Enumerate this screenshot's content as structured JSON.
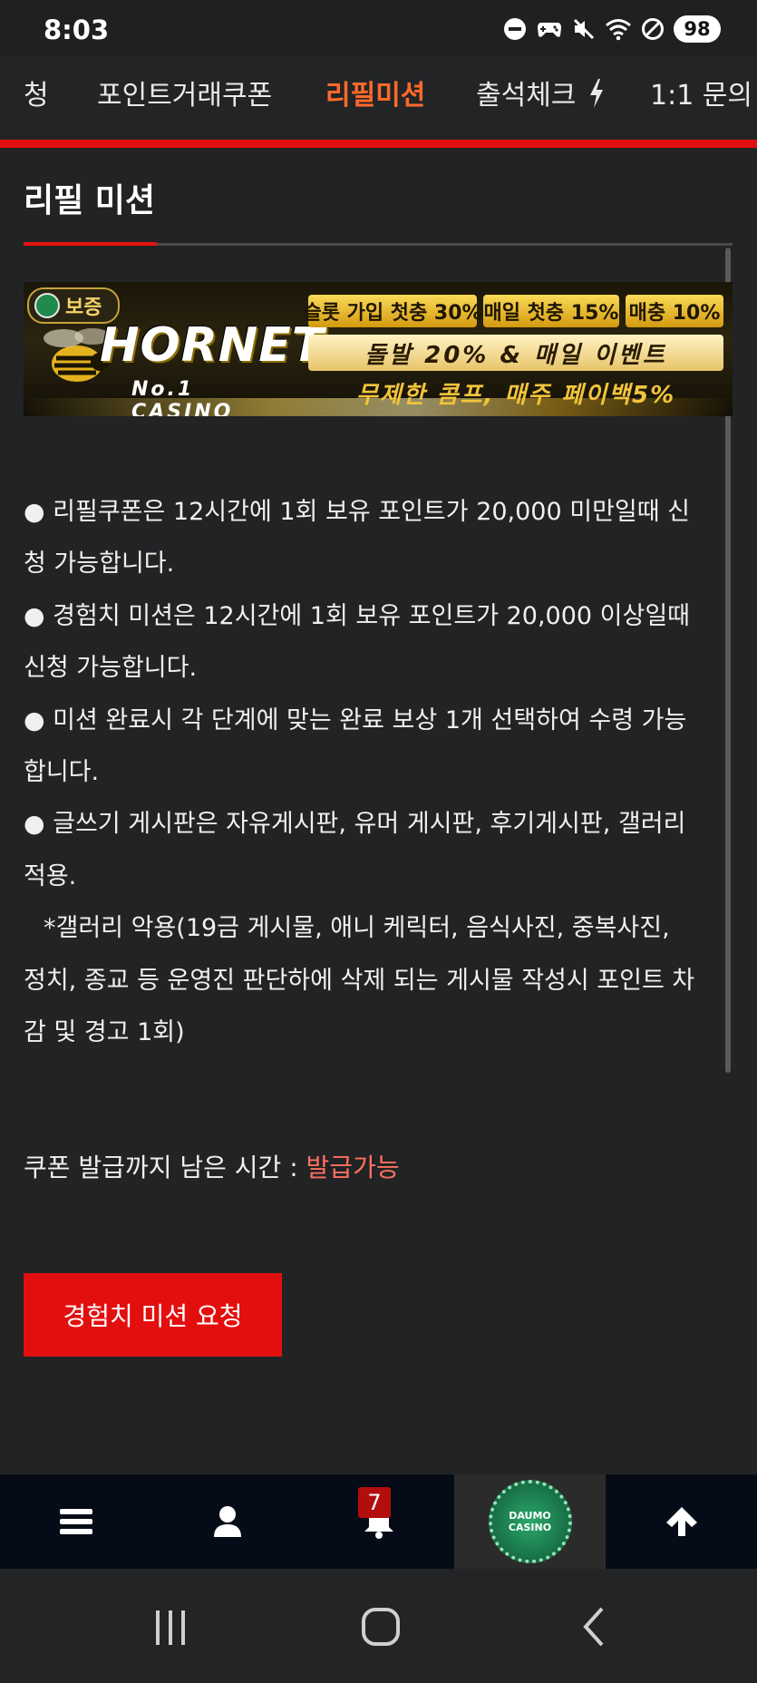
{
  "status_bar": {
    "time": "8:03",
    "icons": [
      "do-not-disturb-icon",
      "game-controller-icon",
      "mute-icon",
      "wifi-icon",
      "blocked-icon"
    ],
    "battery": "98"
  },
  "tabs": [
    {
      "label": "청",
      "active": false
    },
    {
      "label": "포인트거래쿠폰",
      "active": false
    },
    {
      "label": "리필미션",
      "active": true
    },
    {
      "label": "출석체크",
      "active": false,
      "icon": "lightning-icon"
    },
    {
      "label": "1:1 문의",
      "active": false
    }
  ],
  "page": {
    "title": "리필 미션"
  },
  "banner": {
    "badge": "보증",
    "logo_text": "HORNET",
    "logo_sub": "No.1 CASINO",
    "chips": [
      "슬롯 가입 첫충 30%",
      "매일 첫충 15%",
      "매충 10%"
    ],
    "promo": "돌발 20% & 매일 이벤트",
    "promo_line": "무제한 콤프, 매주 페이백5%"
  },
  "info_lines": [
    "● 리필쿠폰은 12시간에 1회 보유 포인트가 20,000 미만일때 신",
    "청 가능합니다.",
    "● 경험치 미션은 12시간에 1회 보유 포인트가 20,000 이상일때",
    "신청 가능합니다.",
    "● 미션 완료시 각 단계에 맞는 완료 보상 1개 선택하여 수령 가능",
    "합니다.",
    "● 글쓰기 게시판은 자유게시판, 유머 게시판, 후기게시판, 갤러리",
    "적용.",
    "*갤러리 악용(19금 게시물, 애니 케릭터, 음식사진, 중복사진,",
    "정치, 종교 등 운영진 판단하에 삭제 되는 게시물 작성시 포인트 차",
    "감 및 경고 1회)"
  ],
  "coupon": {
    "label": "쿠폰 발급까지 남은 시간 : ",
    "status": "발급가능"
  },
  "mission_button": "경험치 미션 요청",
  "bottom_nav": {
    "items": [
      "menu-icon",
      "user-icon",
      "bell-icon",
      "daumo-casino-logo",
      "arrow-up-icon"
    ],
    "notification_count": "7",
    "logo_text": "DAUMO CASINO"
  },
  "colors": {
    "accent_red": "#e30f0f",
    "active_tab": "#ff6a2a",
    "status_highlight": "#ff7060"
  }
}
